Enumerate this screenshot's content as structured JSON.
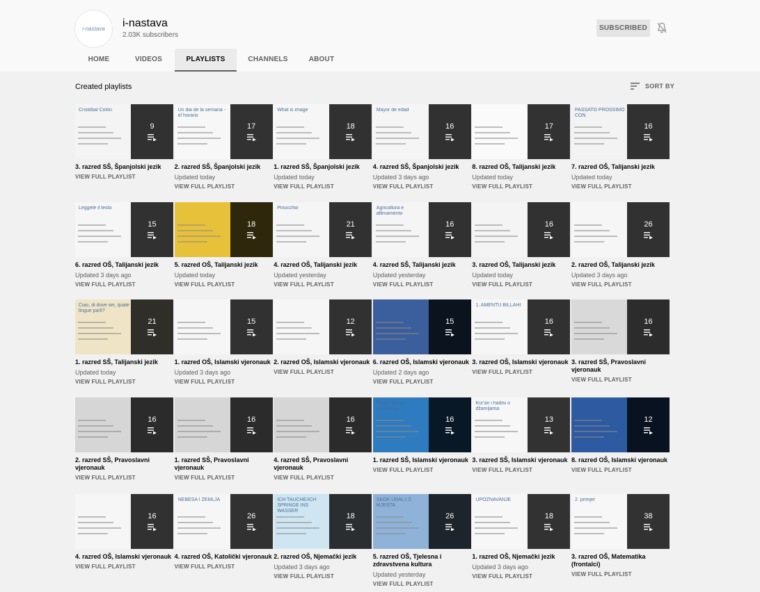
{
  "channel": {
    "avatar_text": "i-nastava",
    "name": "i-nastava",
    "subscribers": "2.03K subscribers",
    "subscribe_label": "SUBSCRIBED",
    "bell_icon": "bell-off-icon"
  },
  "tabs": [
    {
      "label": "HOME"
    },
    {
      "label": "VIDEOS"
    },
    {
      "label": "PLAYLISTS",
      "active": true
    },
    {
      "label": "CHANNELS"
    },
    {
      "label": "ABOUT"
    }
  ],
  "section": {
    "title": "Created playlists",
    "sort_label": "SORT BY"
  },
  "playlists": [
    {
      "title": "3. razred SŠ, Španjolski jezik",
      "count": "9",
      "updated": "",
      "action": "VIEW FULL PLAYLIST",
      "thumb": "Cristóbal Colón",
      "thumb_bg": "#f4f4f4"
    },
    {
      "title": "2. razred SŠ, Španjolski jezik",
      "count": "17",
      "updated": "Updated today",
      "action": "VIEW FULL PLAYLIST",
      "thumb": "Un dia de la semana - el horario",
      "thumb_bg": "#f7f7f7"
    },
    {
      "title": "1. razred SŠ, Španjolski jezik",
      "count": "18",
      "updated": "Updated today",
      "action": "VIEW FULL PLAYLIST",
      "thumb": "What is image",
      "thumb_bg": "#f6f6f6"
    },
    {
      "title": "4. razred SŠ, Španjolski jezik",
      "count": "16",
      "updated": "Updated 3 days ago",
      "action": "VIEW FULL PLAYLIST",
      "thumb": "Mayor de edad",
      "thumb_bg": "#f5f5f5"
    },
    {
      "title": "8. razred OŠ, Talijanski jezik",
      "count": "17",
      "updated": "Updated today",
      "action": "VIEW FULL PLAYLIST",
      "thumb": "",
      "thumb_bg": "#fafafa"
    },
    {
      "title": "7. razred OŠ, Talijanski jezik",
      "count": "16",
      "updated": "Updated today",
      "action": "VIEW FULL PLAYLIST",
      "thumb": "PASSATO PROSSIMO CON",
      "thumb_bg": "#f3f3f3"
    },
    {
      "title": "6. razred OŠ, Talijanski jezik",
      "count": "15",
      "updated": "Updated 3 days ago",
      "action": "VIEW FULL PLAYLIST",
      "thumb": "Leggete il testo",
      "thumb_bg": "#f6f6f6"
    },
    {
      "title": "5. razred OŠ, Talijanski jezik",
      "count": "18",
      "updated": "Updated today",
      "action": "VIEW FULL PLAYLIST",
      "thumb": "",
      "thumb_bg": "#e8c13a"
    },
    {
      "title": "4. razred OŠ, Talijanski jezik",
      "count": "21",
      "updated": "Updated yesterday",
      "action": "VIEW FULL PLAYLIST",
      "thumb": "Pinocchio",
      "thumb_bg": "#f5f5f5"
    },
    {
      "title": "4. razred SŠ, Talijanski jezik",
      "count": "16",
      "updated": "Updated yesterday",
      "action": "VIEW FULL PLAYLIST",
      "thumb": "Agricoltura e allevamento",
      "thumb_bg": "#f5f5f5"
    },
    {
      "title": "3. razred OŠ, Talijanski jezik",
      "count": "16",
      "updated": "Updated today",
      "action": "VIEW FULL PLAYLIST",
      "thumb": "",
      "thumb_bg": "#f4f4f4"
    },
    {
      "title": "2. razred OŠ, Talijanski jezik",
      "count": "26",
      "updated": "Updated 3 days ago",
      "action": "VIEW FULL PLAYLIST",
      "thumb": "",
      "thumb_bg": "#f6f6f6"
    },
    {
      "title": "1. razred SŠ, Talijanski jezik",
      "count": "21",
      "updated": "Updated today",
      "action": "VIEW FULL PLAYLIST",
      "thumb": "Ciao, di dove sei, quale lingue parli?",
      "thumb_bg": "#f0e4c6"
    },
    {
      "title": "1. razred OŠ, Islamski vjeronauk",
      "count": "15",
      "updated": "Updated 3 days ago",
      "action": "VIEW FULL PLAYLIST",
      "thumb": "",
      "thumb_bg": "#f6f6f6"
    },
    {
      "title": "2. razred OŠ, Islamski vjeronauk",
      "count": "12",
      "updated": "",
      "action": "VIEW FULL PLAYLIST",
      "thumb": "",
      "thumb_bg": "#f6f6f6"
    },
    {
      "title": "6. razred OŠ, Islamski vjeronauk",
      "count": "15",
      "updated": "Updated 2 days ago",
      "action": "VIEW FULL PLAYLIST",
      "thumb": "",
      "thumb_bg": "#3b5e9c"
    },
    {
      "title": "3. razred OŠ, Islamski vjeronauk",
      "count": "16",
      "updated": "",
      "action": "VIEW FULL PLAYLIST",
      "thumb": "1. AMENTU BILLAHI",
      "thumb_bg": "#f6f6f6"
    },
    {
      "title": "3. razred SŠ, Pravoslavni vjeronauk",
      "count": "16",
      "updated": "",
      "action": "VIEW FULL PLAYLIST",
      "thumb": "",
      "thumb_bg": "#d9d9d9"
    },
    {
      "title": "2. razred SŠ, Pravoslavni vjeronauk",
      "count": "16",
      "updated": "",
      "action": "VIEW FULL PLAYLIST",
      "thumb": "",
      "thumb_bg": "#d6d6d6"
    },
    {
      "title": "1. razred SŠ, Pravoslavni vjeronauk",
      "count": "16",
      "updated": "",
      "action": "VIEW FULL PLAYLIST",
      "thumb": "",
      "thumb_bg": "#d6d6d6"
    },
    {
      "title": "4. razred SŠ, Pravoslavni vjeronauk",
      "count": "16",
      "updated": "",
      "action": "VIEW FULL PLAYLIST",
      "thumb": "",
      "thumb_bg": "#d6d6d6"
    },
    {
      "title": "1. razred SŠ, Islamski vjeronauk",
      "count": "16",
      "updated": "",
      "action": "VIEW FULL PLAYLIST",
      "thumb": "Pojam vjere i vjerovanja",
      "thumb_bg": "#2e7bbf"
    },
    {
      "title": "3. razred SŠ, Islamski vjeronauk",
      "count": "13",
      "updated": "",
      "action": "VIEW FULL PLAYLIST",
      "thumb": "Kur'an i hadisi o džamijama",
      "thumb_bg": "#f7f7f7"
    },
    {
      "title": "8. razred OŠ, Islamski vjeronauk",
      "count": "12",
      "updated": "",
      "action": "VIEW FULL PLAYLIST",
      "thumb": "",
      "thumb_bg": "#2d5aa0"
    },
    {
      "title": "4. razred OŠ, Islamski vjeronauk",
      "count": "16",
      "updated": "",
      "action": "VIEW FULL PLAYLIST",
      "thumb": "",
      "thumb_bg": "#f6f6f6"
    },
    {
      "title": "4. razred OŠ, Katolički vjeronauk",
      "count": "26",
      "updated": "",
      "action": "VIEW FULL PLAYLIST",
      "thumb": "NEBESA I ZEMLJA",
      "thumb_bg": "#f6f6f6"
    },
    {
      "title": "2. razred OŠ, Njemački jezik",
      "count": "18",
      "updated": "Updated 3 days ago",
      "action": "VIEW FULL PLAYLIST",
      "thumb": "ICH TAUCHE/ICH SPRINGE INS WASSER",
      "thumb_bg": "#cfe6f2"
    },
    {
      "title": "5. razred OŠ, Tjelesna i zdravstvena kultura",
      "count": "26",
      "updated": "Updated yesterday",
      "action": "VIEW FULL PLAYLIST",
      "thumb": "SKOK UDALJ S MJESTA",
      "thumb_bg": "#8fb3d8"
    },
    {
      "title": "1. razred OŠ, Njemački jezik",
      "count": "18",
      "updated": "Updated 3 days ago",
      "action": "VIEW FULL PLAYLIST",
      "thumb": "UPOZNAVANJE",
      "thumb_bg": "#f7f7f7"
    },
    {
      "title": "3. razred OŠ, Matematika (frontalci)",
      "count": "38",
      "updated": "",
      "action": "VIEW FULL PLAYLIST",
      "thumb": "2. primjer",
      "thumb_bg": "#f7f7f7"
    }
  ]
}
